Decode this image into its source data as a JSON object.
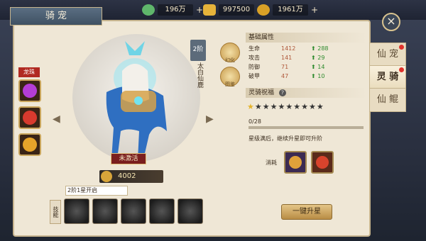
{
  "currencies": [
    {
      "icon": "jade-coin-icon",
      "value": "196万"
    },
    {
      "icon": "gold-ingot-icon",
      "value": "997500"
    },
    {
      "icon": "coin-stack-icon",
      "value": "1961万"
    }
  ],
  "plus_symbol": "+",
  "panel_title": "骑 宠",
  "close_symbol": "×",
  "side_tabs": [
    {
      "label": "仙 宠",
      "active": false,
      "badge": true
    },
    {
      "label": "灵 骑",
      "active": true,
      "badge": true
    },
    {
      "label": "仙 鲲",
      "active": false,
      "badge": false
    }
  ],
  "mount": {
    "stage": "2阶",
    "name": "太白仙鹿",
    "status": "未激活",
    "power": "4002",
    "power_badge": "战"
  },
  "lotus_buttons": [
    {
      "label": "幻化"
    },
    {
      "label": "图鉴"
    }
  ],
  "dragon_pearl": {
    "label": "龙珠",
    "pearls": [
      {
        "color": "#b43dd6"
      },
      {
        "color": "#d83a2e"
      },
      {
        "color": "#e6a32a"
      }
    ]
  },
  "skills": {
    "label": "技能",
    "tip": "2阶1星开启",
    "count": 5
  },
  "attributes": {
    "title": "基础属性",
    "rows": [
      {
        "name": "生命",
        "value": "1412",
        "gain": "288"
      },
      {
        "name": "攻击",
        "value": "141",
        "gain": "29"
      },
      {
        "name": "防御",
        "value": "71",
        "gain": "14"
      },
      {
        "name": "破甲",
        "value": "47",
        "gain": "10"
      }
    ],
    "gain_arrow": "⬆"
  },
  "blessing": {
    "title": "灵骑祝福",
    "help": "?",
    "stars_total": 10,
    "stars_filled": 1,
    "progress": "0/28",
    "progress_fraction": 0.0,
    "hint": "星级满后，继续升星即可升阶",
    "cost_label": "消耗",
    "cost_items": [
      {
        "color": "#e0a13a"
      },
      {
        "color": "#d8432c"
      }
    ],
    "upgrade_label": "一键升星"
  },
  "nav": {
    "left": "◀",
    "right": "▶"
  }
}
